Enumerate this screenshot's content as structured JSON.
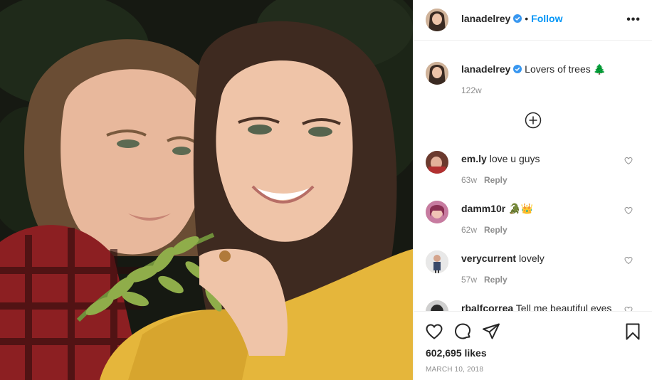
{
  "post": {
    "username": "lanadelrey",
    "follow_label": "Follow",
    "dot": "•",
    "more_label": "•••",
    "caption_text": "Lovers of trees",
    "caption_emoji": "🌲",
    "caption_age": "122w",
    "likes": "602,695 likes",
    "date": "MARCH 10, 2018"
  },
  "comments": [
    {
      "username": "em.ly",
      "text": "love u guys",
      "age": "63w",
      "reply_label": "Reply"
    },
    {
      "username": "damm10r",
      "text": "🐊👑",
      "age": "62w",
      "reply_label": "Reply"
    },
    {
      "username": "verycurrent",
      "text": "lovely",
      "age": "57w",
      "reply_label": "Reply"
    },
    {
      "username": "rbalfcorrea",
      "text": "Tell me beautiful eyes",
      "age": "",
      "reply_label": ""
    }
  ],
  "icons": {
    "verified": "verified-badge-icon",
    "load_more": "plus-circle-icon",
    "like": "heart-icon",
    "comment": "comment-bubble-icon",
    "share": "paper-plane-icon",
    "save": "bookmark-icon",
    "more": "ellipsis-icon"
  },
  "colors": {
    "accent": "#0095f6",
    "text": "#262626",
    "muted": "#8e8e8e",
    "divider": "#efefef"
  }
}
